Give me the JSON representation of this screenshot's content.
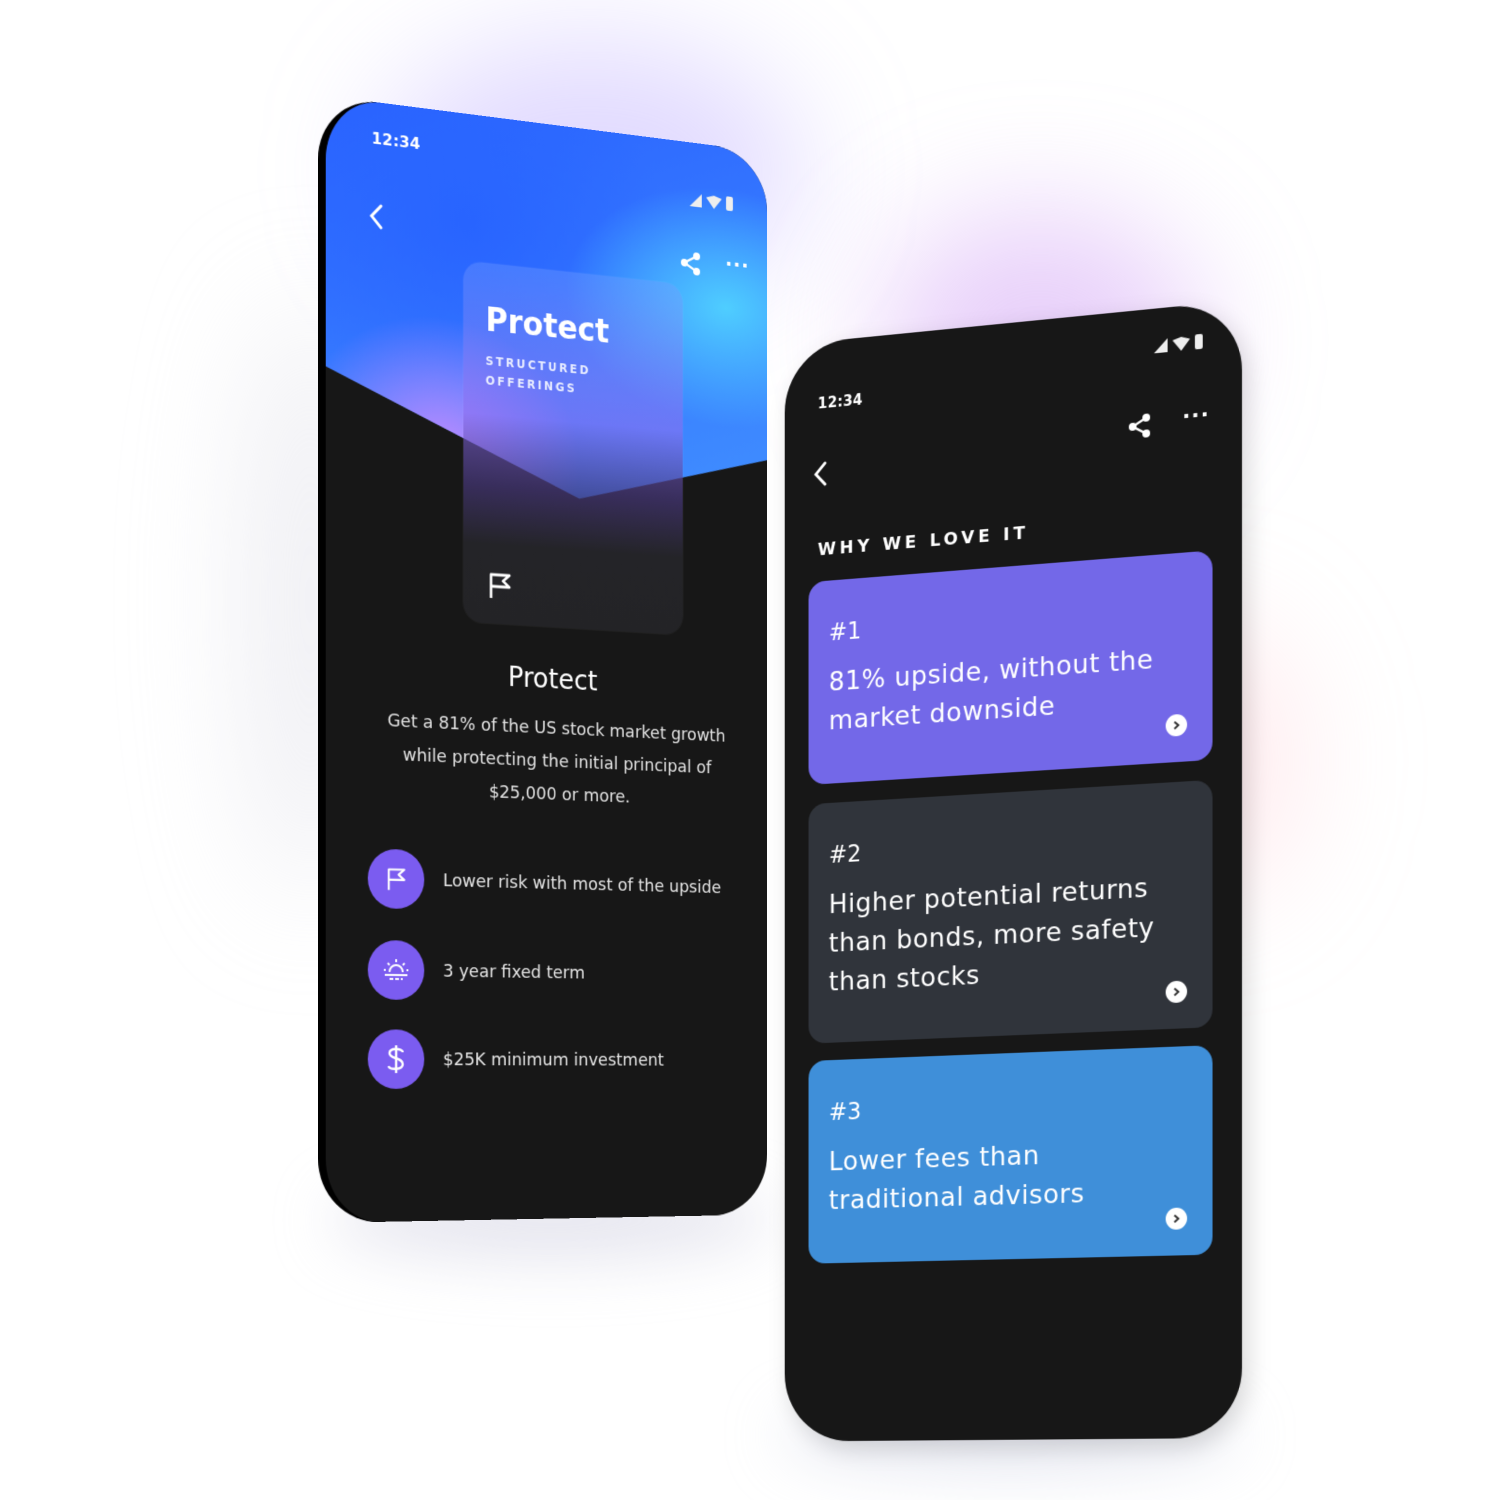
{
  "colors": {
    "phone_bg": "#171717",
    "accent_purple": "#7b5cf0",
    "card1": "#7368e8",
    "card2": "#30343b",
    "card3": "#3f8fd9"
  },
  "back_screen": {
    "status": {
      "time": "12:34"
    },
    "product_card": {
      "title": "Protect",
      "subtitle": "STRUCTURED OFFERINGS",
      "icon": "flag-icon"
    },
    "title": "Protect",
    "description_lines": [
      "Get a 81% of the US stock market growth",
      "while protecting the  initial principal of",
      "$25,000 or more."
    ],
    "features": [
      {
        "icon": "flag-icon",
        "text": "Lower risk with most of the upside"
      },
      {
        "icon": "sunrise-icon",
        "text": "3 year fixed term"
      },
      {
        "icon": "dollar-icon",
        "text": "$25K minimum investment"
      }
    ]
  },
  "front_screen": {
    "status": {
      "time": "12:34"
    },
    "section_label": "WHY WE LOVE IT",
    "reasons": [
      {
        "number": "#1",
        "text": "81% upside, without the market downside"
      },
      {
        "number": "#2",
        "text": "Higher potential returns than bonds, more safety than stocks"
      },
      {
        "number": "#3",
        "text": "Lower fees than traditional advisors"
      }
    ]
  }
}
